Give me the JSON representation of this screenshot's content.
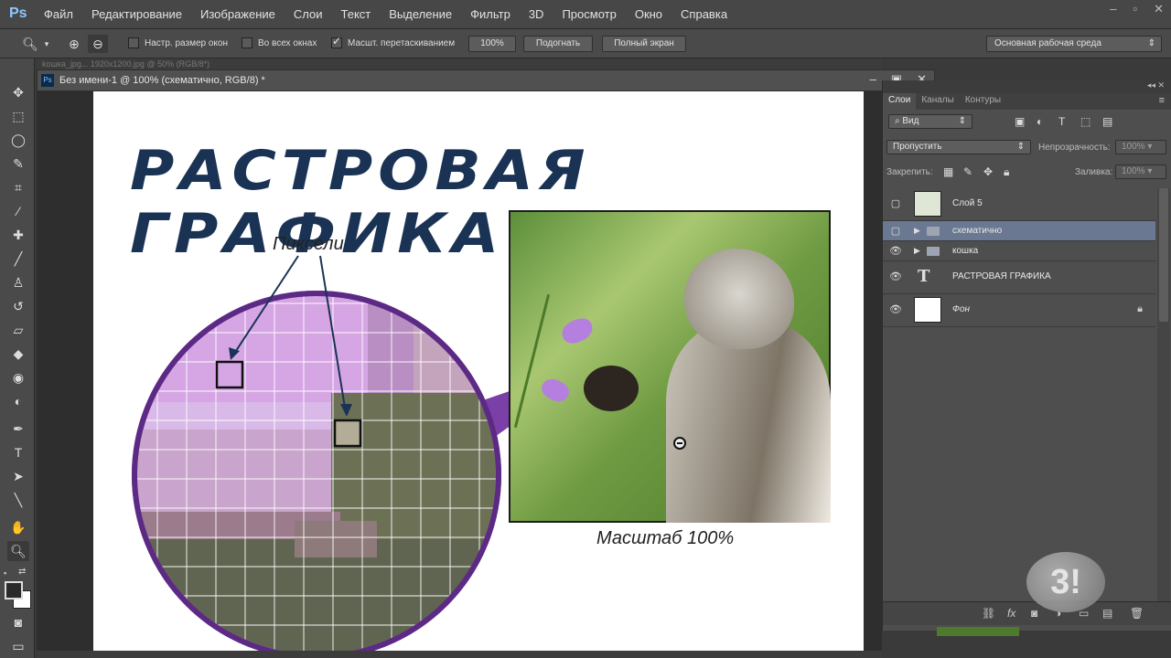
{
  "app": {
    "logo": "Ps"
  },
  "menu": [
    "Файл",
    "Редактирование",
    "Изображение",
    "Слои",
    "Текст",
    "Выделение",
    "Фильтр",
    "3D",
    "Просмотр",
    "Окно",
    "Справка"
  ],
  "options": {
    "chk1": "Настр. размер окон",
    "chk2": "Во всех окнах",
    "chk3": "Масшт. перетаскиванием",
    "btn100": "100%",
    "btnFit": "Подогнать",
    "btnFull": "Полный экран",
    "workspace": "Основная рабочая среда"
  },
  "document": {
    "back_tab": "koшка_jpg... 1920x1200.jpg @ 50% (RGB/8*)",
    "title": "Без имени-1 @ 100% (схематично, RGB/8) *"
  },
  "canvas": {
    "heading": "РАСТРОВАЯ ГРАФИКА",
    "pixels_label": "Пиксели",
    "scale_label": "Масштаб 100%"
  },
  "panel": {
    "tabs": [
      "Слои",
      "Каналы",
      "Контуры"
    ],
    "filter": "Вид",
    "blend": "Пропустить",
    "opacity_label": "Непрозрачность:",
    "opacity_value": "100%",
    "lock_label": "Закрепить:",
    "fill_label": "Заливка:",
    "fill_value": "100%",
    "layers": [
      {
        "name": "Слой 5"
      },
      {
        "name": "схематично"
      },
      {
        "name": "кошка"
      },
      {
        "name": "РАСТРОВАЯ ГРАФИКА"
      },
      {
        "name": "Фон"
      }
    ]
  },
  "colors": {
    "accent": "#6a7891",
    "bubble": "#7b3fa8",
    "heading": "#1a3355"
  }
}
